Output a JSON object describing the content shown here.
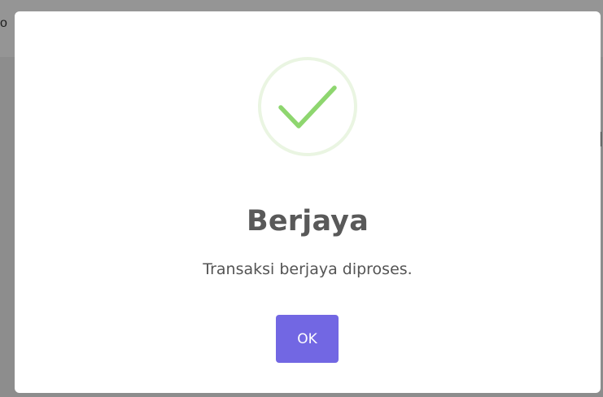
{
  "background": {
    "partial_text": "o"
  },
  "dialog": {
    "icon": "success-check-icon",
    "title": "Berjaya",
    "message": "Transaksi berjaya diproses.",
    "ok_label": "OK"
  },
  "colors": {
    "accent": "#7267e3",
    "success": "#8ed66f",
    "success_ring": "#eaf5e2",
    "overlay": "#8d8d8d",
    "title_text": "#595959",
    "body_text": "#545454"
  }
}
